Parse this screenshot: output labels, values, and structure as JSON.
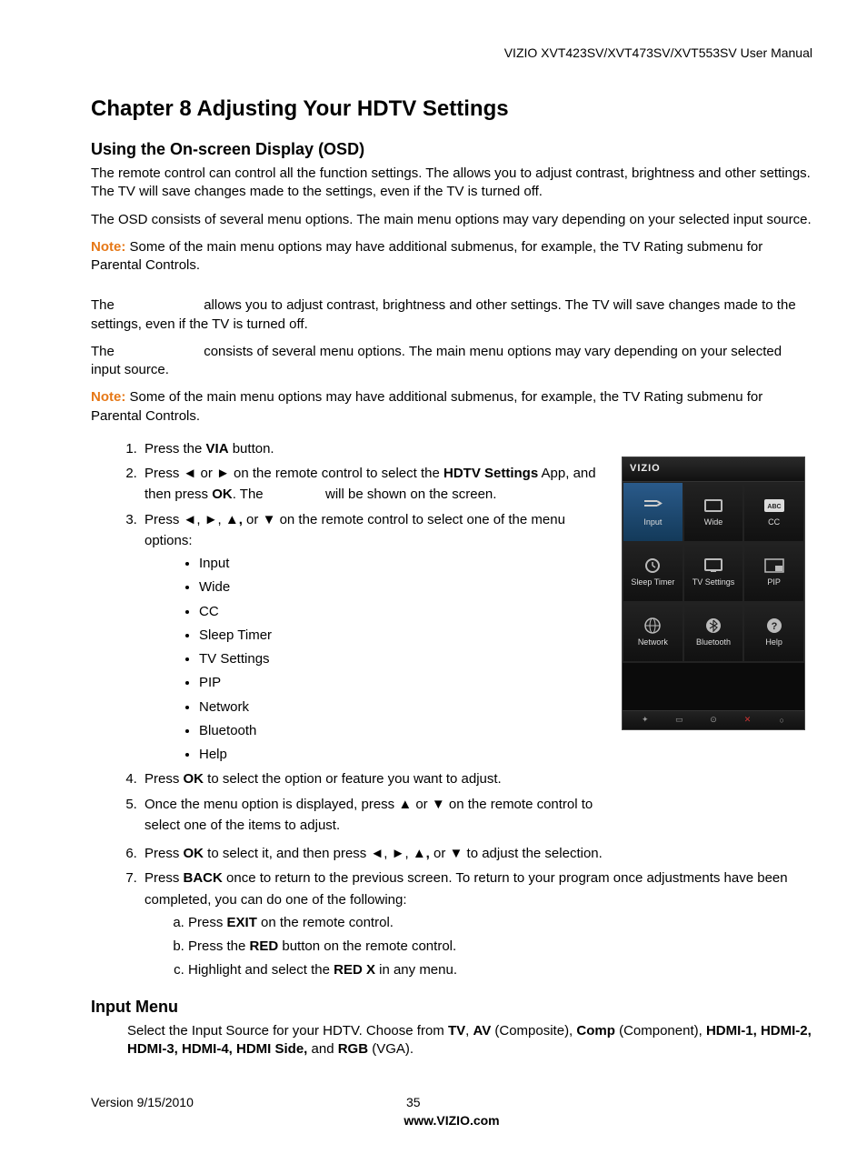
{
  "header": "VIZIO XVT423SV/XVT473SV/XVT553SV User Manual",
  "chapter_title": "Chapter 8 Adjusting Your HDTV Settings",
  "section1_title": "Using the On-screen Display (OSD)",
  "intro1a": "The remote control can control all the function settings. The ",
  "intro1b": " allows you to adjust contrast, brightness and other settings. The TV will save changes made to the settings, even if the TV is turned off.",
  "intro2": "The OSD consists of several menu options. The main menu options may vary depending on your selected input source.",
  "note_label": "Note:",
  "note1_text": "  Some of the main menu options may have additional submenus, for example, the TV Rating submenu for Parental Controls.",
  "p3a": "The ",
  "p3b": " allows you to adjust contrast, brightness and other settings. The TV will save changes made to the settings, even if the TV is turned off.",
  "p4a": "The ",
  "p4b": " consists of several menu options. The main menu options may vary depending on your selected input source.",
  "note2_text": "  Some of the main menu options may have additional submenus, for example, the TV Rating submenu for Parental Controls.",
  "steps": {
    "s1_a": "Press the ",
    "s1_b": "VIA",
    "s1_c": " button.",
    "s2_a": "Press ◄ or ► on the remote control to select the ",
    "s2_b": "HDTV Settings",
    "s2_c": " App, and then press ",
    "s2_d": "OK",
    "s2_e": ". The ",
    "s2_f": " will be shown on the screen.",
    "s3_a": "Press ◄, ►, ▲",
    "s3_b": ",",
    "s3_c": " or ▼ on the remote control to select one of the menu options:",
    "bullets": [
      "Input",
      "Wide",
      "CC",
      "Sleep Timer",
      "TV Settings",
      "PIP",
      "Network",
      "Bluetooth",
      "Help"
    ],
    "s4_a": "Press ",
    "s4_b": "OK",
    "s4_c": " to select the option or feature you want to adjust.",
    "s5": "Once the menu option is displayed, press ▲ or ▼ on the remote control to select one of the items to adjust.",
    "s6_a": "Press ",
    "s6_b": "OK",
    "s6_c": " to select it, and then press ◄, ►, ▲",
    "s6_d": ",",
    "s6_e": " or ▼ to adjust the selection.",
    "s7_a": "Press ",
    "s7_b": "BACK",
    "s7_c": " once to return to the previous screen. To return to your program once adjustments have been completed, you can do one of the following:",
    "s7_sub_a1": "Press ",
    "s7_sub_a2": "EXIT",
    "s7_sub_a3": " on the remote control.",
    "s7_sub_b1": "Press the ",
    "s7_sub_b2": "RED",
    "s7_sub_b3": " button on the remote control.",
    "s7_sub_c1": "Highlight and select the ",
    "s7_sub_c2": "RED X",
    "s7_sub_c3": " in any menu."
  },
  "osd": {
    "brand": "VIZIO",
    "tiles": [
      {
        "label": "Input",
        "selected": true
      },
      {
        "label": "Wide",
        "selected": false
      },
      {
        "label": "CC",
        "selected": false
      },
      {
        "label": "Sleep Timer",
        "selected": false
      },
      {
        "label": "TV Settings",
        "selected": false
      },
      {
        "label": "PIP",
        "selected": false
      },
      {
        "label": "Network",
        "selected": false
      },
      {
        "label": "Bluetooth",
        "selected": false
      },
      {
        "label": "Help",
        "selected": false
      }
    ]
  },
  "section2_title": "Input Menu",
  "input_menu_a": "Select the Input Source for your HDTV. Choose from ",
  "input_menu_b": "TV",
  "input_menu_c": ", ",
  "input_menu_d": "AV",
  "input_menu_e": " (Composite), ",
  "input_menu_f": "Comp",
  "input_menu_g": " (Component), ",
  "input_menu_h": "HDMI-1, HDMI-2, HDMI-3, HDMI-4, HDMI Side,",
  "input_menu_i": " and ",
  "input_menu_j": "RGB",
  "input_menu_k": " (VGA).",
  "footer": {
    "version": "Version 9/15/2010",
    "page": "35",
    "url": "www.VIZIO.com"
  }
}
